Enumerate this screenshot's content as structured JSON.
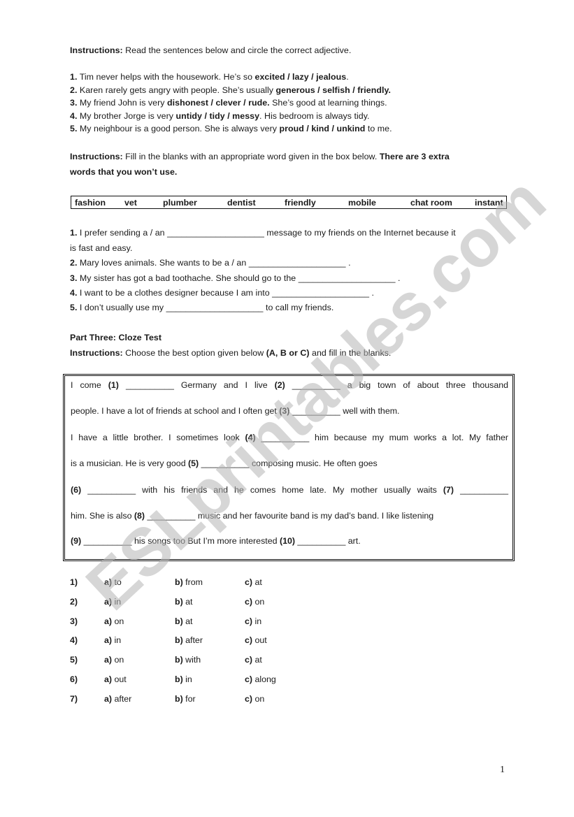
{
  "section1": {
    "instructions_label": "Instructions:",
    "instructions_text": "  Read the sentences below and circle the correct adjective.",
    "items": [
      {
        "num": "1.",
        "before": " Tim never helps with the housework. He’s so ",
        "choices": "excited / lazy / jealous",
        "after": "."
      },
      {
        "num": "2.",
        "before": " Karen rarely gets angry with people. She’s usually ",
        "choices": "generous / selfish / friendly.",
        "after": ""
      },
      {
        "num": "3.",
        "before": " My friend John is very ",
        "choices": "dishonest / clever / rude.",
        "after": " She’s good at   learning things."
      },
      {
        "num": "4.",
        "before": " My brother Jorge is very ",
        "choices": "untidy / tidy / messy",
        "after": ". His bedroom is always tidy."
      },
      {
        "num": "5.",
        "before": " My neighbour is a good person. She is always very ",
        "choices": "proud / kind / unkind",
        "after": " to me."
      }
    ]
  },
  "section2": {
    "instructions_label": "Instructions:",
    "instructions_text": " Fill in the blanks with an appropriate word given in the box below. ",
    "instructions_bold": "There are 3 extra",
    "instructions_bold_line2": "words that you won’t use.",
    "word_box": [
      "fashion",
      "vet",
      "plumber",
      "dentist",
      "friendly",
      "mobile",
      "chat room",
      "instant"
    ],
    "items": [
      {
        "num": "1.",
        "text": " I prefer sending a / an ____________________ message to my friends on the Internet because it"
      },
      {
        "num": "",
        "text": "is fast and easy."
      },
      {
        "num": "2.",
        "text": " Mary loves animals. She wants to be a / an   ____________________ ."
      },
      {
        "num": "3.",
        "text": " My sister has got a bad toothache. She should go to the ____________________ ."
      },
      {
        "num": "4.",
        "text": " I want to be a clothes designer because I am into ____________________ ."
      },
      {
        "num": "5.",
        "text": " I don’t usually use my ____________________ to call my friends."
      }
    ]
  },
  "section3": {
    "title": "Part Three:  Cloze Test",
    "instructions_label": "Instructions:",
    "instructions_text": "  Choose the best option given below ",
    "instructions_bold": "(A, B or C)",
    "instructions_after": " and fill in the blanks.",
    "cloze_lines": [
      [
        {
          "t": "I come "
        },
        {
          "b": "(1)"
        },
        {
          "t": " __________ Germany and I live "
        },
        {
          "b": "(2)"
        },
        {
          "t": " __________ a big town of about three thousand"
        }
      ],
      [
        {
          "t": "people. I have a lot of friends at school and I often get "
        },
        {
          "b": "(3)"
        },
        {
          "t": " __________ well with them."
        }
      ],
      [
        {
          "t": "I have a little brother. I sometimes look "
        },
        {
          "b": "(4)"
        },
        {
          "t": " __________ him because my mum works a lot. My father"
        }
      ],
      [
        {
          "t": "is a musician. He is very good "
        },
        {
          "b": "(5)"
        },
        {
          "t": " __________ composing music. He often goes"
        }
      ],
      [
        {
          "b": "(6)"
        },
        {
          "t": " __________ with his friends and he comes home late. My mother usually waits "
        },
        {
          "b": "(7)"
        },
        {
          "t": " __________"
        }
      ],
      [
        {
          "t": "him. She is also "
        },
        {
          "b": "(8)"
        },
        {
          "t": " __________ music and her favourite band is my dad’s band. I like listening"
        }
      ],
      [
        {
          "b": "(9)"
        },
        {
          "t": " __________ his songs too But I’m more interested "
        },
        {
          "b": "(10)"
        },
        {
          "t": " __________ art."
        }
      ]
    ],
    "options": [
      {
        "num": "1)",
        "a": "to",
        "b": "from",
        "c": "at"
      },
      {
        "num": "2)",
        "a": "in",
        "b": "at",
        "c": "on"
      },
      {
        "num": "3)",
        "a": "on",
        "b": "at",
        "c": "in"
      },
      {
        "num": "4)",
        "a": "in",
        "b": "after",
        "c": "out"
      },
      {
        "num": "5)",
        "a": "on",
        "b": "with",
        "c": "at"
      },
      {
        "num": "6)",
        "a": "out",
        "b": "in",
        "c": "along"
      },
      {
        "num": "7)",
        "a": "after",
        "b": "for",
        "c": "on"
      }
    ],
    "labels": {
      "a": "a)",
      "b": "b)",
      "c": "c)"
    }
  },
  "page_number": "1",
  "watermark": "ESLprintables.com"
}
